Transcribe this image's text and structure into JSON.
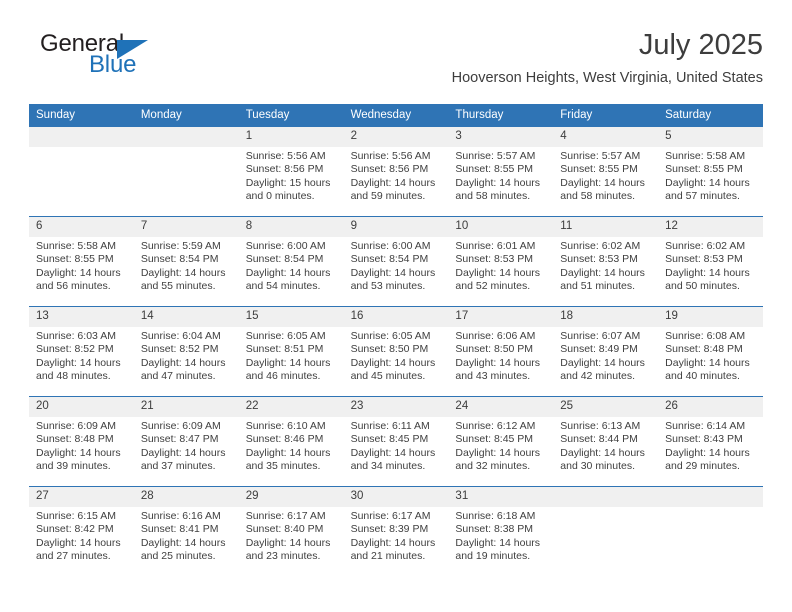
{
  "brand": {
    "name_top": "General",
    "name_bottom": "Blue",
    "triangle_color": "#1f72b8"
  },
  "header": {
    "title": "July 2025",
    "location": "Hooverson Heights, West Virginia, United States"
  },
  "theme": {
    "header_blue": "#2f74b5",
    "day_band_gray": "#f0f0f0",
    "text_color": "#3d3d3d"
  },
  "weekdays": [
    "Sunday",
    "Monday",
    "Tuesday",
    "Wednesday",
    "Thursday",
    "Friday",
    "Saturday"
  ],
  "weeks": [
    [
      {
        "day": "",
        "sunrise": "",
        "sunset": "",
        "daylight_1": "",
        "daylight_2": "",
        "empty": true
      },
      {
        "day": "",
        "sunrise": "",
        "sunset": "",
        "daylight_1": "",
        "daylight_2": "",
        "empty": true
      },
      {
        "day": "1",
        "sunrise": "Sunrise: 5:56 AM",
        "sunset": "Sunset: 8:56 PM",
        "daylight_1": "Daylight: 15 hours",
        "daylight_2": "and 0 minutes."
      },
      {
        "day": "2",
        "sunrise": "Sunrise: 5:56 AM",
        "sunset": "Sunset: 8:56 PM",
        "daylight_1": "Daylight: 14 hours",
        "daylight_2": "and 59 minutes."
      },
      {
        "day": "3",
        "sunrise": "Sunrise: 5:57 AM",
        "sunset": "Sunset: 8:55 PM",
        "daylight_1": "Daylight: 14 hours",
        "daylight_2": "and 58 minutes."
      },
      {
        "day": "4",
        "sunrise": "Sunrise: 5:57 AM",
        "sunset": "Sunset: 8:55 PM",
        "daylight_1": "Daylight: 14 hours",
        "daylight_2": "and 58 minutes."
      },
      {
        "day": "5",
        "sunrise": "Sunrise: 5:58 AM",
        "sunset": "Sunset: 8:55 PM",
        "daylight_1": "Daylight: 14 hours",
        "daylight_2": "and 57 minutes."
      }
    ],
    [
      {
        "day": "6",
        "sunrise": "Sunrise: 5:58 AM",
        "sunset": "Sunset: 8:55 PM",
        "daylight_1": "Daylight: 14 hours",
        "daylight_2": "and 56 minutes."
      },
      {
        "day": "7",
        "sunrise": "Sunrise: 5:59 AM",
        "sunset": "Sunset: 8:54 PM",
        "daylight_1": "Daylight: 14 hours",
        "daylight_2": "and 55 minutes."
      },
      {
        "day": "8",
        "sunrise": "Sunrise: 6:00 AM",
        "sunset": "Sunset: 8:54 PM",
        "daylight_1": "Daylight: 14 hours",
        "daylight_2": "and 54 minutes."
      },
      {
        "day": "9",
        "sunrise": "Sunrise: 6:00 AM",
        "sunset": "Sunset: 8:54 PM",
        "daylight_1": "Daylight: 14 hours",
        "daylight_2": "and 53 minutes."
      },
      {
        "day": "10",
        "sunrise": "Sunrise: 6:01 AM",
        "sunset": "Sunset: 8:53 PM",
        "daylight_1": "Daylight: 14 hours",
        "daylight_2": "and 52 minutes."
      },
      {
        "day": "11",
        "sunrise": "Sunrise: 6:02 AM",
        "sunset": "Sunset: 8:53 PM",
        "daylight_1": "Daylight: 14 hours",
        "daylight_2": "and 51 minutes."
      },
      {
        "day": "12",
        "sunrise": "Sunrise: 6:02 AM",
        "sunset": "Sunset: 8:53 PM",
        "daylight_1": "Daylight: 14 hours",
        "daylight_2": "and 50 minutes."
      }
    ],
    [
      {
        "day": "13",
        "sunrise": "Sunrise: 6:03 AM",
        "sunset": "Sunset: 8:52 PM",
        "daylight_1": "Daylight: 14 hours",
        "daylight_2": "and 48 minutes."
      },
      {
        "day": "14",
        "sunrise": "Sunrise: 6:04 AM",
        "sunset": "Sunset: 8:52 PM",
        "daylight_1": "Daylight: 14 hours",
        "daylight_2": "and 47 minutes."
      },
      {
        "day": "15",
        "sunrise": "Sunrise: 6:05 AM",
        "sunset": "Sunset: 8:51 PM",
        "daylight_1": "Daylight: 14 hours",
        "daylight_2": "and 46 minutes."
      },
      {
        "day": "16",
        "sunrise": "Sunrise: 6:05 AM",
        "sunset": "Sunset: 8:50 PM",
        "daylight_1": "Daylight: 14 hours",
        "daylight_2": "and 45 minutes."
      },
      {
        "day": "17",
        "sunrise": "Sunrise: 6:06 AM",
        "sunset": "Sunset: 8:50 PM",
        "daylight_1": "Daylight: 14 hours",
        "daylight_2": "and 43 minutes."
      },
      {
        "day": "18",
        "sunrise": "Sunrise: 6:07 AM",
        "sunset": "Sunset: 8:49 PM",
        "daylight_1": "Daylight: 14 hours",
        "daylight_2": "and 42 minutes."
      },
      {
        "day": "19",
        "sunrise": "Sunrise: 6:08 AM",
        "sunset": "Sunset: 8:48 PM",
        "daylight_1": "Daylight: 14 hours",
        "daylight_2": "and 40 minutes."
      }
    ],
    [
      {
        "day": "20",
        "sunrise": "Sunrise: 6:09 AM",
        "sunset": "Sunset: 8:48 PM",
        "daylight_1": "Daylight: 14 hours",
        "daylight_2": "and 39 minutes."
      },
      {
        "day": "21",
        "sunrise": "Sunrise: 6:09 AM",
        "sunset": "Sunset: 8:47 PM",
        "daylight_1": "Daylight: 14 hours",
        "daylight_2": "and 37 minutes."
      },
      {
        "day": "22",
        "sunrise": "Sunrise: 6:10 AM",
        "sunset": "Sunset: 8:46 PM",
        "daylight_1": "Daylight: 14 hours",
        "daylight_2": "and 35 minutes."
      },
      {
        "day": "23",
        "sunrise": "Sunrise: 6:11 AM",
        "sunset": "Sunset: 8:45 PM",
        "daylight_1": "Daylight: 14 hours",
        "daylight_2": "and 34 minutes."
      },
      {
        "day": "24",
        "sunrise": "Sunrise: 6:12 AM",
        "sunset": "Sunset: 8:45 PM",
        "daylight_1": "Daylight: 14 hours",
        "daylight_2": "and 32 minutes."
      },
      {
        "day": "25",
        "sunrise": "Sunrise: 6:13 AM",
        "sunset": "Sunset: 8:44 PM",
        "daylight_1": "Daylight: 14 hours",
        "daylight_2": "and 30 minutes."
      },
      {
        "day": "26",
        "sunrise": "Sunrise: 6:14 AM",
        "sunset": "Sunset: 8:43 PM",
        "daylight_1": "Daylight: 14 hours",
        "daylight_2": "and 29 minutes."
      }
    ],
    [
      {
        "day": "27",
        "sunrise": "Sunrise: 6:15 AM",
        "sunset": "Sunset: 8:42 PM",
        "daylight_1": "Daylight: 14 hours",
        "daylight_2": "and 27 minutes."
      },
      {
        "day": "28",
        "sunrise": "Sunrise: 6:16 AM",
        "sunset": "Sunset: 8:41 PM",
        "daylight_1": "Daylight: 14 hours",
        "daylight_2": "and 25 minutes."
      },
      {
        "day": "29",
        "sunrise": "Sunrise: 6:17 AM",
        "sunset": "Sunset: 8:40 PM",
        "daylight_1": "Daylight: 14 hours",
        "daylight_2": "and 23 minutes."
      },
      {
        "day": "30",
        "sunrise": "Sunrise: 6:17 AM",
        "sunset": "Sunset: 8:39 PM",
        "daylight_1": "Daylight: 14 hours",
        "daylight_2": "and 21 minutes."
      },
      {
        "day": "31",
        "sunrise": "Sunrise: 6:18 AM",
        "sunset": "Sunset: 8:38 PM",
        "daylight_1": "Daylight: 14 hours",
        "daylight_2": "and 19 minutes."
      },
      {
        "day": "",
        "sunrise": "",
        "sunset": "",
        "daylight_1": "",
        "daylight_2": "",
        "empty": true
      },
      {
        "day": "",
        "sunrise": "",
        "sunset": "",
        "daylight_1": "",
        "daylight_2": "",
        "empty": true
      }
    ]
  ]
}
